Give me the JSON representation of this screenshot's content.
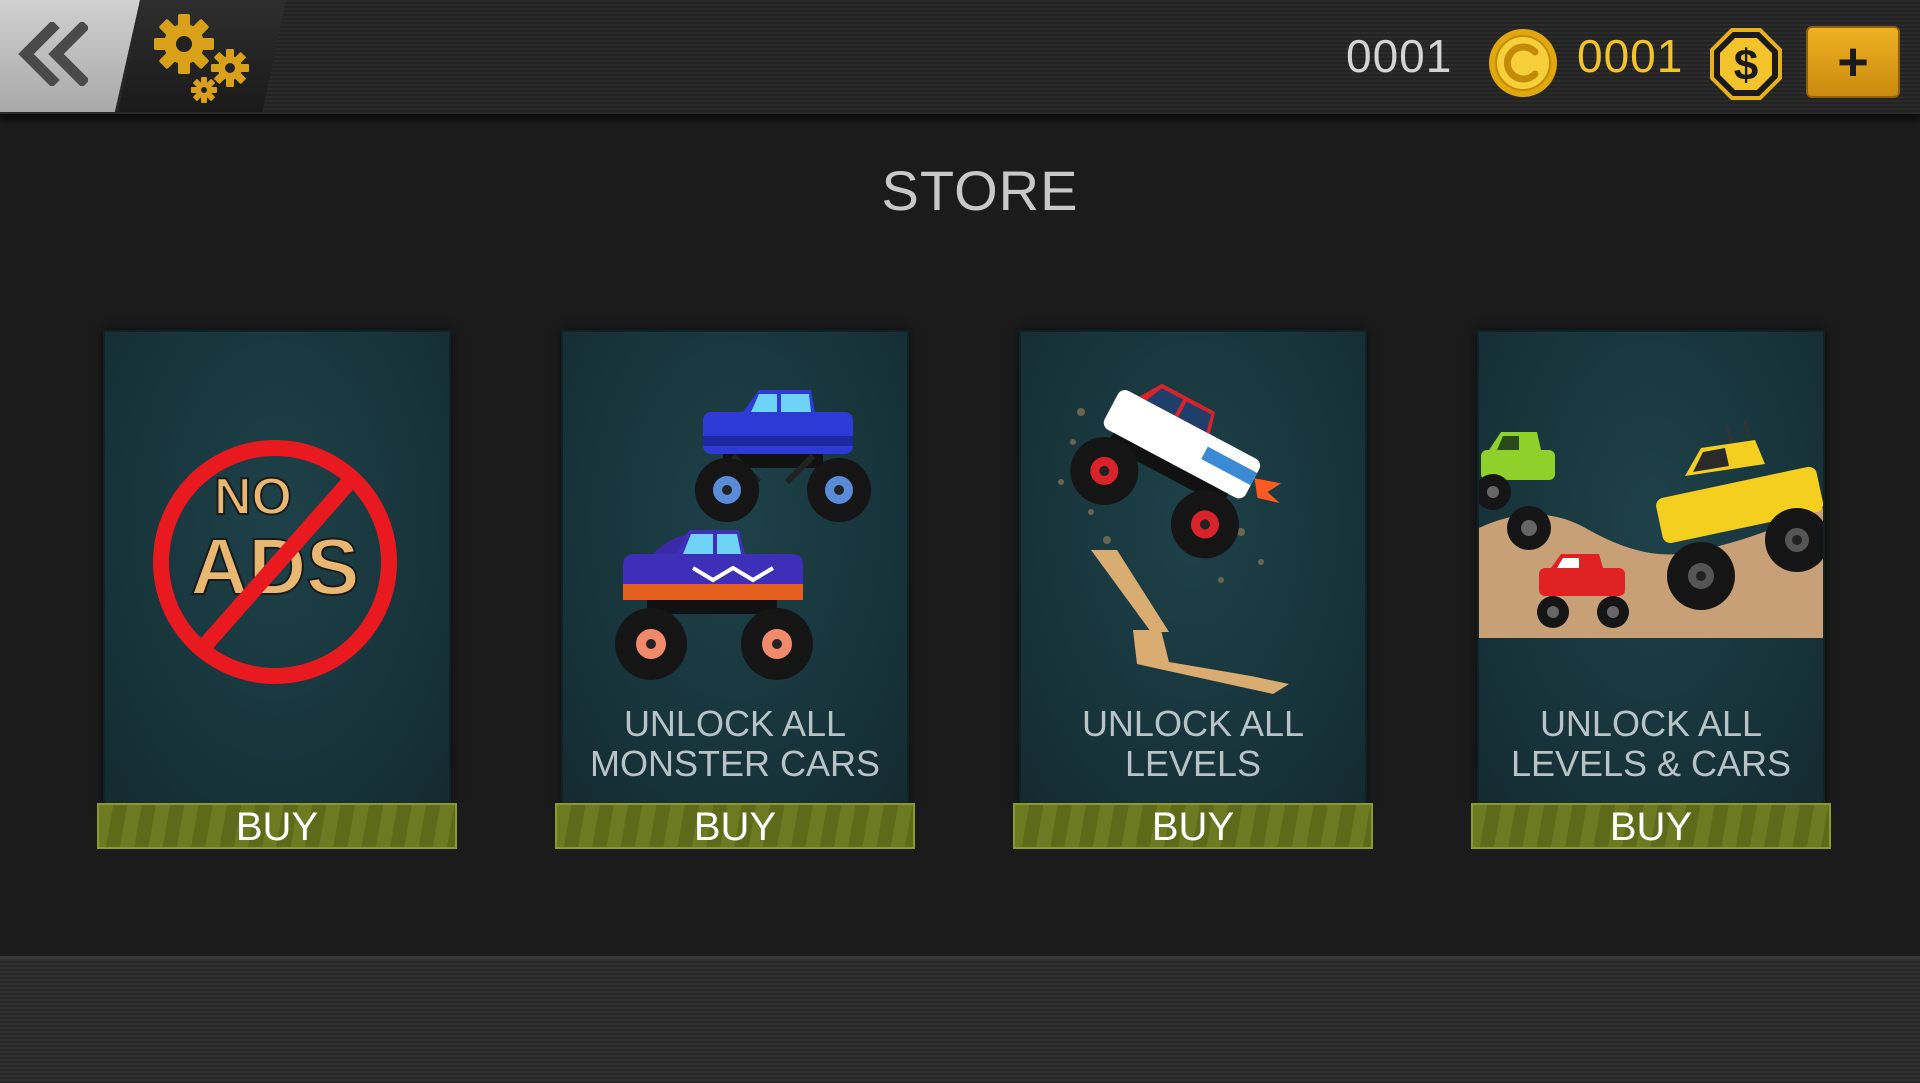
{
  "header": {
    "back_icon": "double-chevron-left-icon",
    "settings_icon": "gears-icon",
    "coins": "0001",
    "coin_icon": "coin-c-icon",
    "cash": "0001",
    "cash_icon": "dollar-badge-icon",
    "add_label": "+"
  },
  "title": "STORE",
  "store": {
    "items": [
      {
        "art_text_1": "NO",
        "art_text_2": "ADS",
        "label_line1": "",
        "label_line2": "",
        "buy": "BUY"
      },
      {
        "label_line1": "UNLOCK ALL",
        "label_line2": "MONSTER CARS",
        "buy": "BUY"
      },
      {
        "label_line1": "UNLOCK ALL",
        "label_line2": "LEVELS",
        "buy": "BUY"
      },
      {
        "label_line1": "UNLOCK ALL",
        "label_line2": "LEVELS & CARS",
        "buy": "BUY"
      }
    ]
  },
  "colors": {
    "background": "#1b1b1b",
    "card": "#1b3a41",
    "buy_button": "#6c7a22",
    "gold": "#f2c32a",
    "no_ads_red": "#e8191f"
  }
}
